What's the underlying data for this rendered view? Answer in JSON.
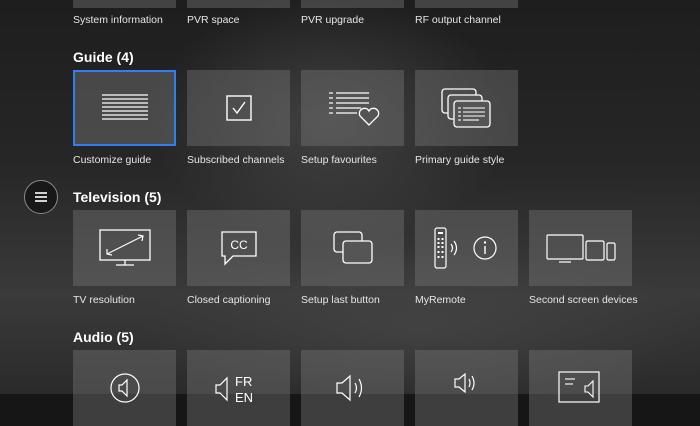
{
  "top_row": {
    "items": [
      {
        "label": "System information",
        "icon": "system-info-icon"
      },
      {
        "label": "PVR space",
        "icon": "pvr-space-icon"
      },
      {
        "label": "PVR upgrade",
        "icon": "pvr-upgrade-icon"
      },
      {
        "label": "RF output channel",
        "icon": "rf-output-icon"
      }
    ]
  },
  "guide": {
    "title": "Guide (4)",
    "items": [
      {
        "label": "Customize guide",
        "icon": "list-icon",
        "selected": true
      },
      {
        "label": "Subscribed channels",
        "icon": "checkbox-icon"
      },
      {
        "label": "Setup favourites",
        "icon": "list-heart-icon"
      },
      {
        "label": "Primary guide style",
        "icon": "stacked-windows-icon"
      }
    ]
  },
  "television": {
    "title": "Television (5)",
    "items": [
      {
        "label": "TV resolution",
        "icon": "tv-resolution-icon"
      },
      {
        "label": "Closed captioning",
        "icon": "closed-caption-icon"
      },
      {
        "label": "Setup last button",
        "icon": "last-button-icon"
      },
      {
        "label": "MyRemote",
        "icon": "remote-info-icon"
      },
      {
        "label": "Second screen devices",
        "icon": "devices-icon"
      }
    ]
  },
  "audio": {
    "title": "Audio (5)",
    "items": [
      {
        "icon": "speaker-icon"
      },
      {
        "icon": "language-fr-icon",
        "text_line1": "FR",
        "text_line2": "EN"
      },
      {
        "icon": "speaker-waves-icon"
      },
      {
        "icon": "speaker-small-icon"
      },
      {
        "icon": "audio-output-icon"
      }
    ]
  },
  "menu": {
    "icon": "hamburger-menu-icon"
  },
  "colors": {
    "accent": "#2f7ff0",
    "tile": "#555555"
  }
}
